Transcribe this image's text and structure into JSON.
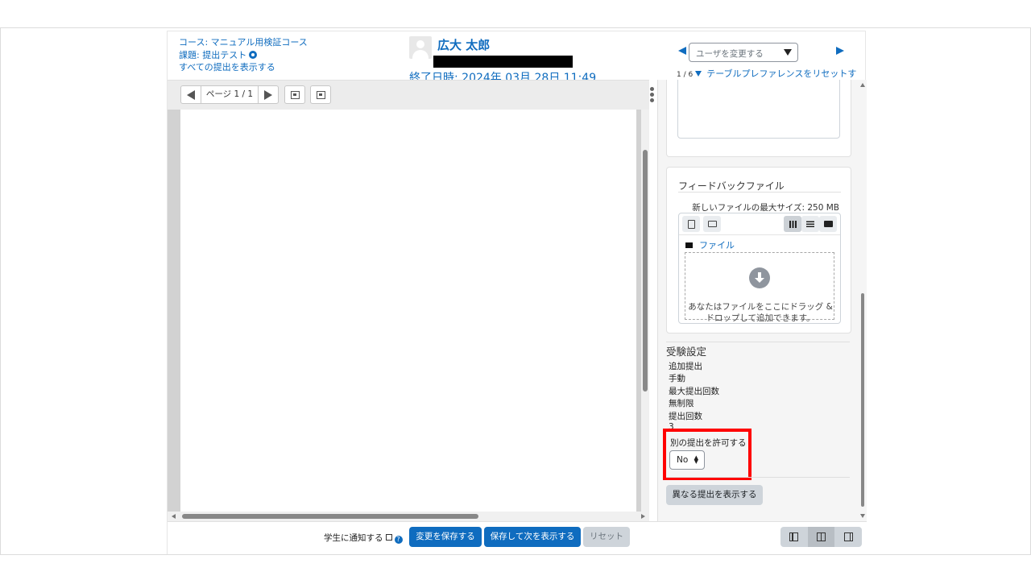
{
  "header": {
    "course_link": "コース: マニュアル用検証コース",
    "assignment_link": "課題: 提出テスト",
    "view_all_link": "すべての提出を表示する",
    "student_name": "広大 太郎",
    "due_date": "終了日時: 2024年 03月 28日 11:49",
    "user_select_placeholder": "ユーザを変更する",
    "user_count": "1 / 6",
    "reset_table_prefs": "テーブルプレファレンスをリセットす"
  },
  "pdf": {
    "page_label": "ページ 1 / 1"
  },
  "feedback_files": {
    "title": "フィードバックファイル",
    "max_size": "新しいファイルの最大サイズ: 250 MB",
    "folder_label": "ファイル",
    "drop_text": "あなたはファイルをここにドラッグ & ドロップして追加できます。"
  },
  "attempt_settings": {
    "title": "受験設定",
    "rows": [
      "追加提出",
      "手動",
      "最大提出回数",
      "無制限",
      "提出回数",
      "3"
    ],
    "allow_another_label": "別の提出を許可する",
    "allow_another_value": "No",
    "view_diff_button": "異なる提出を表示する"
  },
  "footer": {
    "notify_students": "学生に通知する",
    "save_changes": "変更を保存する",
    "save_and_next": "保存して次を表示する",
    "reset": "リセット"
  },
  "colors": {
    "primary": "#0f6cbf",
    "highlight": "#ff0000"
  }
}
